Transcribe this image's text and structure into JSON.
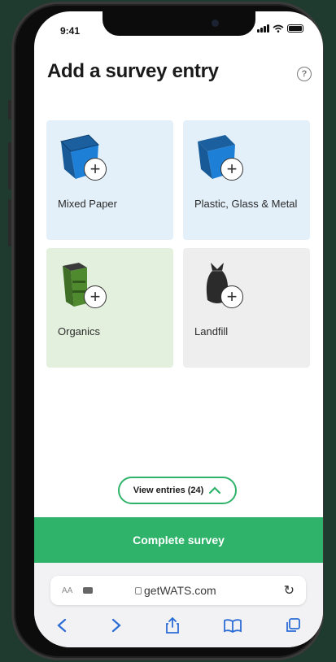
{
  "status_bar": {
    "time": "9:41"
  },
  "header": {
    "title": "Add a survey entry",
    "help_label": "?"
  },
  "categories": [
    {
      "label": "Mixed Paper",
      "bg": "#e3f0fa",
      "icon": "blue-bin-icon"
    },
    {
      "label": "Plastic, Glass & Metal",
      "bg": "#e3f0fa",
      "icon": "blue-bin-icon"
    },
    {
      "label": "Organics",
      "bg": "#e3f0dd",
      "icon": "green-bin-icon"
    },
    {
      "label": "Landfill",
      "bg": "#eeeeee",
      "icon": "trash-bag-icon"
    }
  ],
  "view_entries": {
    "label": "View entries (24)"
  },
  "complete": {
    "label": "Complete survey"
  },
  "browser": {
    "aa": "AA",
    "url": "getWATS.com"
  },
  "colors": {
    "accent": "#2fb36a",
    "bin_blue": "#1e7fd6",
    "bin_green": "#5a8f3a"
  }
}
